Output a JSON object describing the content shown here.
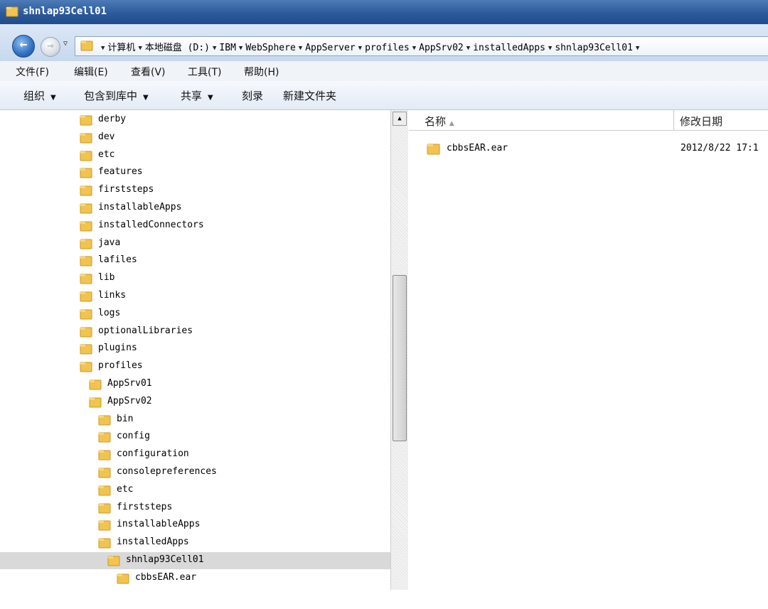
{
  "window": {
    "title": "shnlap93Cell01"
  },
  "address": {
    "breadcrumbs": [
      "计算机",
      "本地磁盘 (D:)",
      "IBM",
      "WebSphere",
      "AppServer",
      "profiles",
      "AppSrv02",
      "installedApps",
      "shnlap93Cell01"
    ]
  },
  "menu": [
    "文件(F)",
    "编辑(E)",
    "查看(V)",
    "工具(T)",
    "帮助(H)"
  ],
  "toolbar": [
    "组织",
    "包含到库中",
    "共享",
    "刻录",
    "新建文件夹"
  ],
  "tree": [
    {
      "label": "derby",
      "level": 0
    },
    {
      "label": "dev",
      "level": 0
    },
    {
      "label": "etc",
      "level": 0
    },
    {
      "label": "features",
      "level": 0
    },
    {
      "label": "firststeps",
      "level": 0
    },
    {
      "label": "installableApps",
      "level": 0
    },
    {
      "label": "installedConnectors",
      "level": 0
    },
    {
      "label": "java",
      "level": 0
    },
    {
      "label": "lafiles",
      "level": 0
    },
    {
      "label": "lib",
      "level": 0
    },
    {
      "label": "links",
      "level": 0
    },
    {
      "label": "logs",
      "level": 0
    },
    {
      "label": "optionalLibraries",
      "level": 0
    },
    {
      "label": "plugins",
      "level": 0
    },
    {
      "label": "profiles",
      "level": 0
    },
    {
      "label": "AppSrv01",
      "level": 1
    },
    {
      "label": "AppSrv02",
      "level": 1
    },
    {
      "label": "bin",
      "level": 2
    },
    {
      "label": "config",
      "level": 2
    },
    {
      "label": "configuration",
      "level": 2
    },
    {
      "label": "consolepreferences",
      "level": 2
    },
    {
      "label": "etc",
      "level": 2
    },
    {
      "label": "firststeps",
      "level": 2
    },
    {
      "label": "installableApps",
      "level": 2
    },
    {
      "label": "installedApps",
      "level": 2
    },
    {
      "label": "shnlap93Cell01",
      "level": 3,
      "selected": true
    },
    {
      "label": "cbbsEAR.ear",
      "level": 4
    }
  ],
  "columns": {
    "name": "名称",
    "modified": "修改日期"
  },
  "files": [
    {
      "name": "cbbsEAR.ear",
      "modified": "2012/8/22 17:1"
    }
  ]
}
